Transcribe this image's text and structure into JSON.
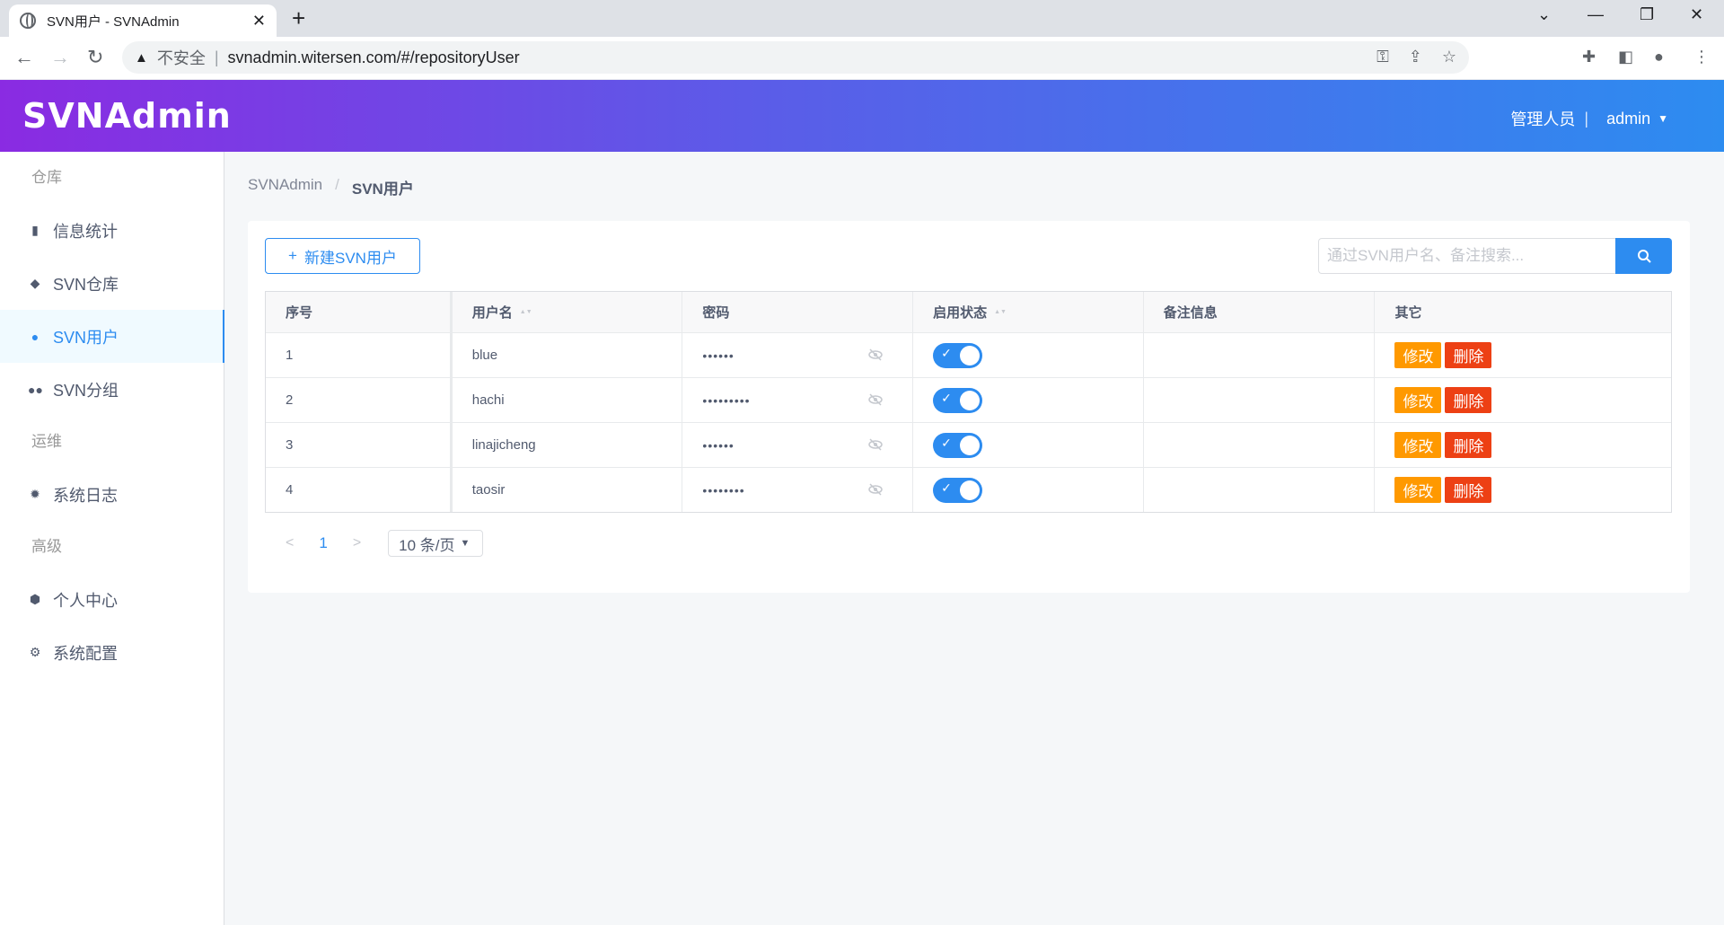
{
  "browser": {
    "tab_title": "SVN用户 - SVNAdmin",
    "tab_close": "✕",
    "new_tab": "+",
    "security_label": "不安全",
    "url": "svnadmin.witersen.com/#/repositoryUser"
  },
  "header": {
    "logo": "SVNAdmin",
    "role": "管理人员",
    "separator": "|",
    "user": "admin"
  },
  "sidebar": {
    "groups": [
      "仓库",
      "运维",
      "高级"
    ],
    "items": [
      {
        "label": "信息统计",
        "icon": "bar-chart-icon"
      },
      {
        "label": "SVN仓库",
        "icon": "layers-icon"
      },
      {
        "label": "SVN用户",
        "icon": "person-icon"
      },
      {
        "label": "SVN分组",
        "icon": "people-icon"
      },
      {
        "label": "系统日志",
        "icon": "bug-icon"
      },
      {
        "label": "个人中心",
        "icon": "cube-icon"
      },
      {
        "label": "系统配置",
        "icon": "gear-icon"
      }
    ],
    "active": "SVN用户"
  },
  "breadcrumb": {
    "root": "SVNAdmin",
    "separator": "/",
    "current": "SVN用户"
  },
  "actions": {
    "new_user_label": "新建SVN用户",
    "search_placeholder": "通过SVN用户名、备注搜索..."
  },
  "table": {
    "columns": [
      "序号",
      "用户名",
      "密码",
      "启用状态",
      "备注信息",
      "其它"
    ],
    "rows": [
      {
        "index": "1",
        "username": "blue",
        "password": "••••••",
        "enabled": true,
        "note": ""
      },
      {
        "index": "2",
        "username": "hachi",
        "password": "•••••••••",
        "enabled": true,
        "note": ""
      },
      {
        "index": "3",
        "username": "linajicheng",
        "password": "••••••",
        "enabled": true,
        "note": ""
      },
      {
        "index": "4",
        "username": "taosir",
        "password": "••••••••",
        "enabled": true,
        "note": ""
      }
    ],
    "edit_label": "修改",
    "delete_label": "删除"
  },
  "pagination": {
    "current_page": "1",
    "page_size": "10 条/页"
  },
  "colors": {
    "primary": "#2d8cf0",
    "warning": "#ff9900",
    "danger": "#ed4014",
    "header_gradient_start": "#8a2be2",
    "header_gradient_end": "#2d8cf0"
  }
}
